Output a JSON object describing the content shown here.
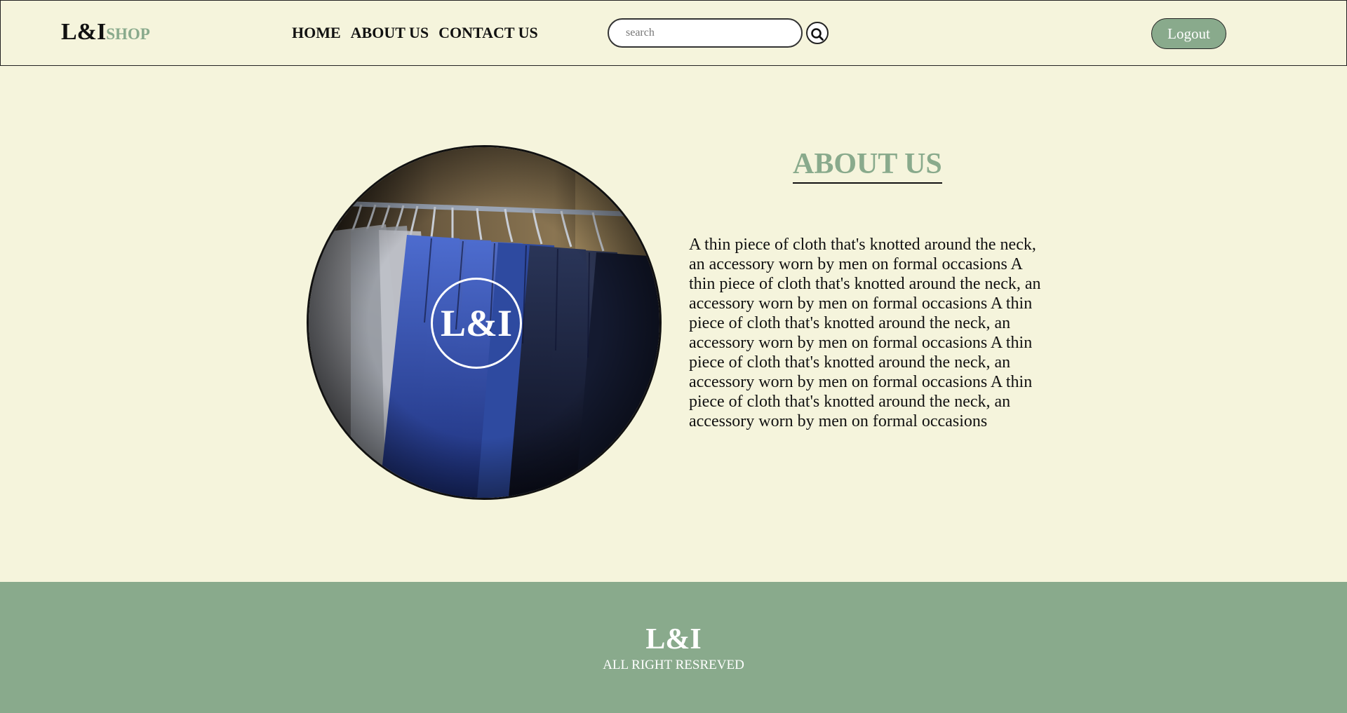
{
  "header": {
    "logo_main": "L&I",
    "logo_sub": "SHOP",
    "nav": [
      {
        "label": "HOME"
      },
      {
        "label": "ABOUT US"
      },
      {
        "label": "CONTACT US"
      }
    ],
    "search": {
      "placeholder": "search",
      "value": "",
      "icon": "search-icon"
    },
    "logout_label": "Logout"
  },
  "main": {
    "emblem": "L&I",
    "title": "ABOUT US",
    "body": "A thin piece of cloth that's knotted around the neck, an accessory worn by men on formal occasions A thin piece of cloth that's knotted around the neck, an accessory worn by men on formal occasions A thin piece of cloth that's knotted around the neck, an accessory worn by men on formal occasions A thin piece of cloth that's knotted around the neck, an accessory worn by men on formal occasions A thin piece of cloth that's knotted around the neck, an accessory worn by men on formal occasions"
  },
  "footer": {
    "logo": "L&I",
    "copyright": "ALL RIGHT RESREVED"
  },
  "colors": {
    "background": "#f5f4dc",
    "accent": "#89aa8c",
    "text": "#111111"
  }
}
